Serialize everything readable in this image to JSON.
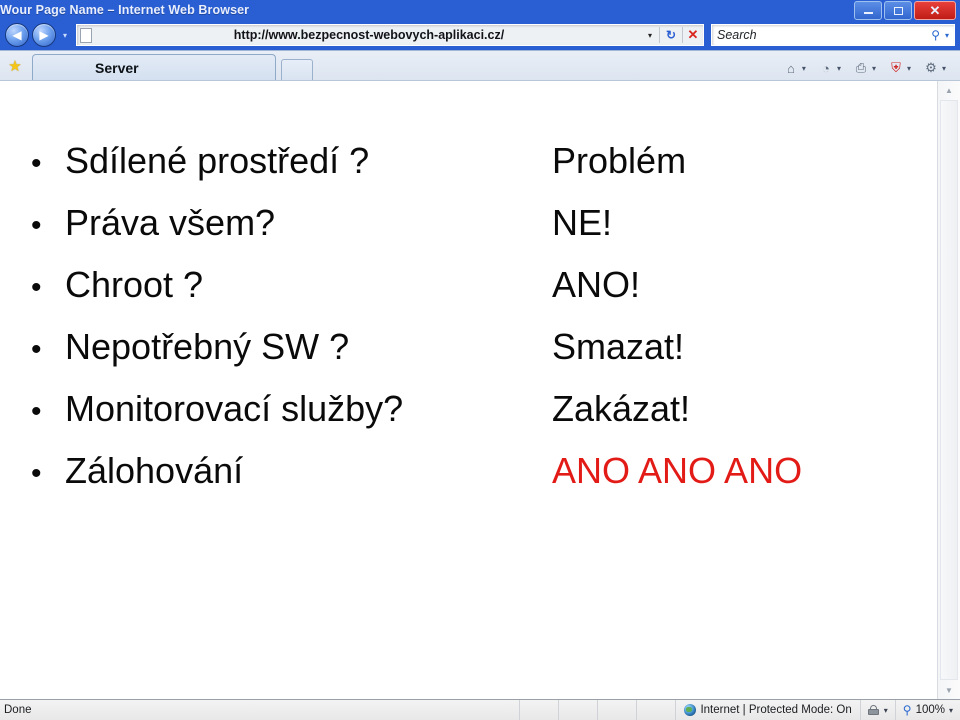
{
  "window": {
    "title": "Wour Page Name – Internet Web Browser",
    "controls": {
      "minimize_label": "minimize",
      "maximize_label": "maximize",
      "close_label": "✕"
    }
  },
  "navbar": {
    "back_icon": "◀",
    "forward_icon": "▶",
    "history_caret": "▾",
    "url": "http://www.bezpecnost-webovych-aplikaci.cz/",
    "url_caret": "▾",
    "refresh_icon": "↻",
    "stop_icon": "✕",
    "search_placeholder": "Search",
    "search_icon": "⚲",
    "search_caret": "▾"
  },
  "tabstrip": {
    "favorites_icon": "★",
    "tabs": [
      {
        "label": "Server"
      }
    ],
    "new_tab_label": "",
    "tools": [
      {
        "name": "home",
        "glyph": "⌂",
        "caret": "▾"
      },
      {
        "name": "feeds",
        "glyph": "◔",
        "caret": "▾"
      },
      {
        "name": "print",
        "glyph": "⎙",
        "caret": "▾"
      },
      {
        "name": "safety",
        "glyph": "⛨",
        "caret": "▾"
      },
      {
        "name": "tools",
        "glyph": "⚙",
        "caret": "▾"
      }
    ]
  },
  "slide": {
    "bullet_glyph": "•",
    "rows": [
      {
        "question": "Sdílené prostředí ?",
        "answer": "Problém",
        "answer_red": false
      },
      {
        "question": "Práva všem?",
        "answer": "NE!",
        "answer_red": false
      },
      {
        "question": "Chroot ?",
        "answer": "ANO!",
        "answer_red": false
      },
      {
        "question": "Nepotřebný SW ?",
        "answer": "Smazat!",
        "answer_red": false
      },
      {
        "question": "Monitorovací služby?",
        "answer": "Zakázat!",
        "answer_red": false
      },
      {
        "question": "Zálohování",
        "answer": "ANO ANO ANO",
        "answer_red": true
      }
    ]
  },
  "scrollbar": {
    "up_icon": "▲",
    "down_icon": "▼"
  },
  "statusbar": {
    "message": "Done",
    "zone": "Internet | Protected Mode: On",
    "zone_caret": "▾",
    "lock_caret": "▾",
    "zoom_icon": "⚲",
    "zoom_level": "100%",
    "zoom_caret": "▾"
  },
  "colors": {
    "chrome_blue": "#2a5fd4",
    "close_red": "#d9251d",
    "accent_red": "#e31b17",
    "star_yellow": "#f5c518"
  }
}
